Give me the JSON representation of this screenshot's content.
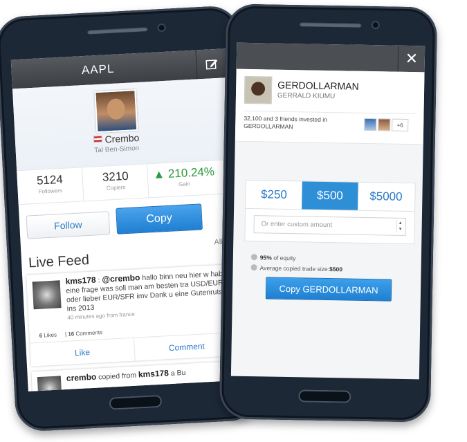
{
  "left": {
    "header_title": "AAPL",
    "profile": {
      "username": "Crembo",
      "real_name": "Tal Ben-Simon"
    },
    "stats": [
      {
        "value": "5124",
        "label": "Followers"
      },
      {
        "value": "3210",
        "label": "Copiers"
      },
      {
        "value": "210.24%",
        "label": "Gain"
      }
    ],
    "follow_label": "Follow",
    "copy_label": "Copy",
    "feed_title": "Live Feed",
    "filter_label": "All",
    "post": {
      "author": "kms178",
      "mention": "@crembo",
      "text": "hallo binn neu hier w habe eine frage was soll man am besten tra USD/EUR oder lieber EUR/SFR imv Dank u eine Gutenrutsch ins 2013",
      "time": "40 minutes ago from france",
      "likes": "6",
      "likes_label": "Likes",
      "comments": "16",
      "comments_label": "Comments",
      "like_action": "Like",
      "comment_action": "Comment"
    },
    "post2": {
      "author": "crembo",
      "text": "copied from",
      "target": "kms178",
      "suffix": "a Bu"
    }
  },
  "right": {
    "close_icon": "close-icon",
    "trader": {
      "name": "GERDOLLARMAN",
      "sub": "GERRALD KIUMU"
    },
    "invested_text": "32,100 and 3 friends invested in GERDOLLARMAN",
    "more_friends": "+6",
    "amounts": [
      "$250",
      "$500",
      "$5000"
    ],
    "selected_amount": "$500",
    "custom_placeholder": "Or enter custom amount",
    "equity_value": "95%",
    "equity_label": "of equity",
    "avg_label": "Average copied trade size:",
    "avg_value": "$500",
    "copy_button": "Copy GERDOLLARMAN"
  },
  "colors": {
    "accent": "#2e8fd7",
    "gain": "#2e9b3e",
    "phone_body": "#1d2836"
  }
}
